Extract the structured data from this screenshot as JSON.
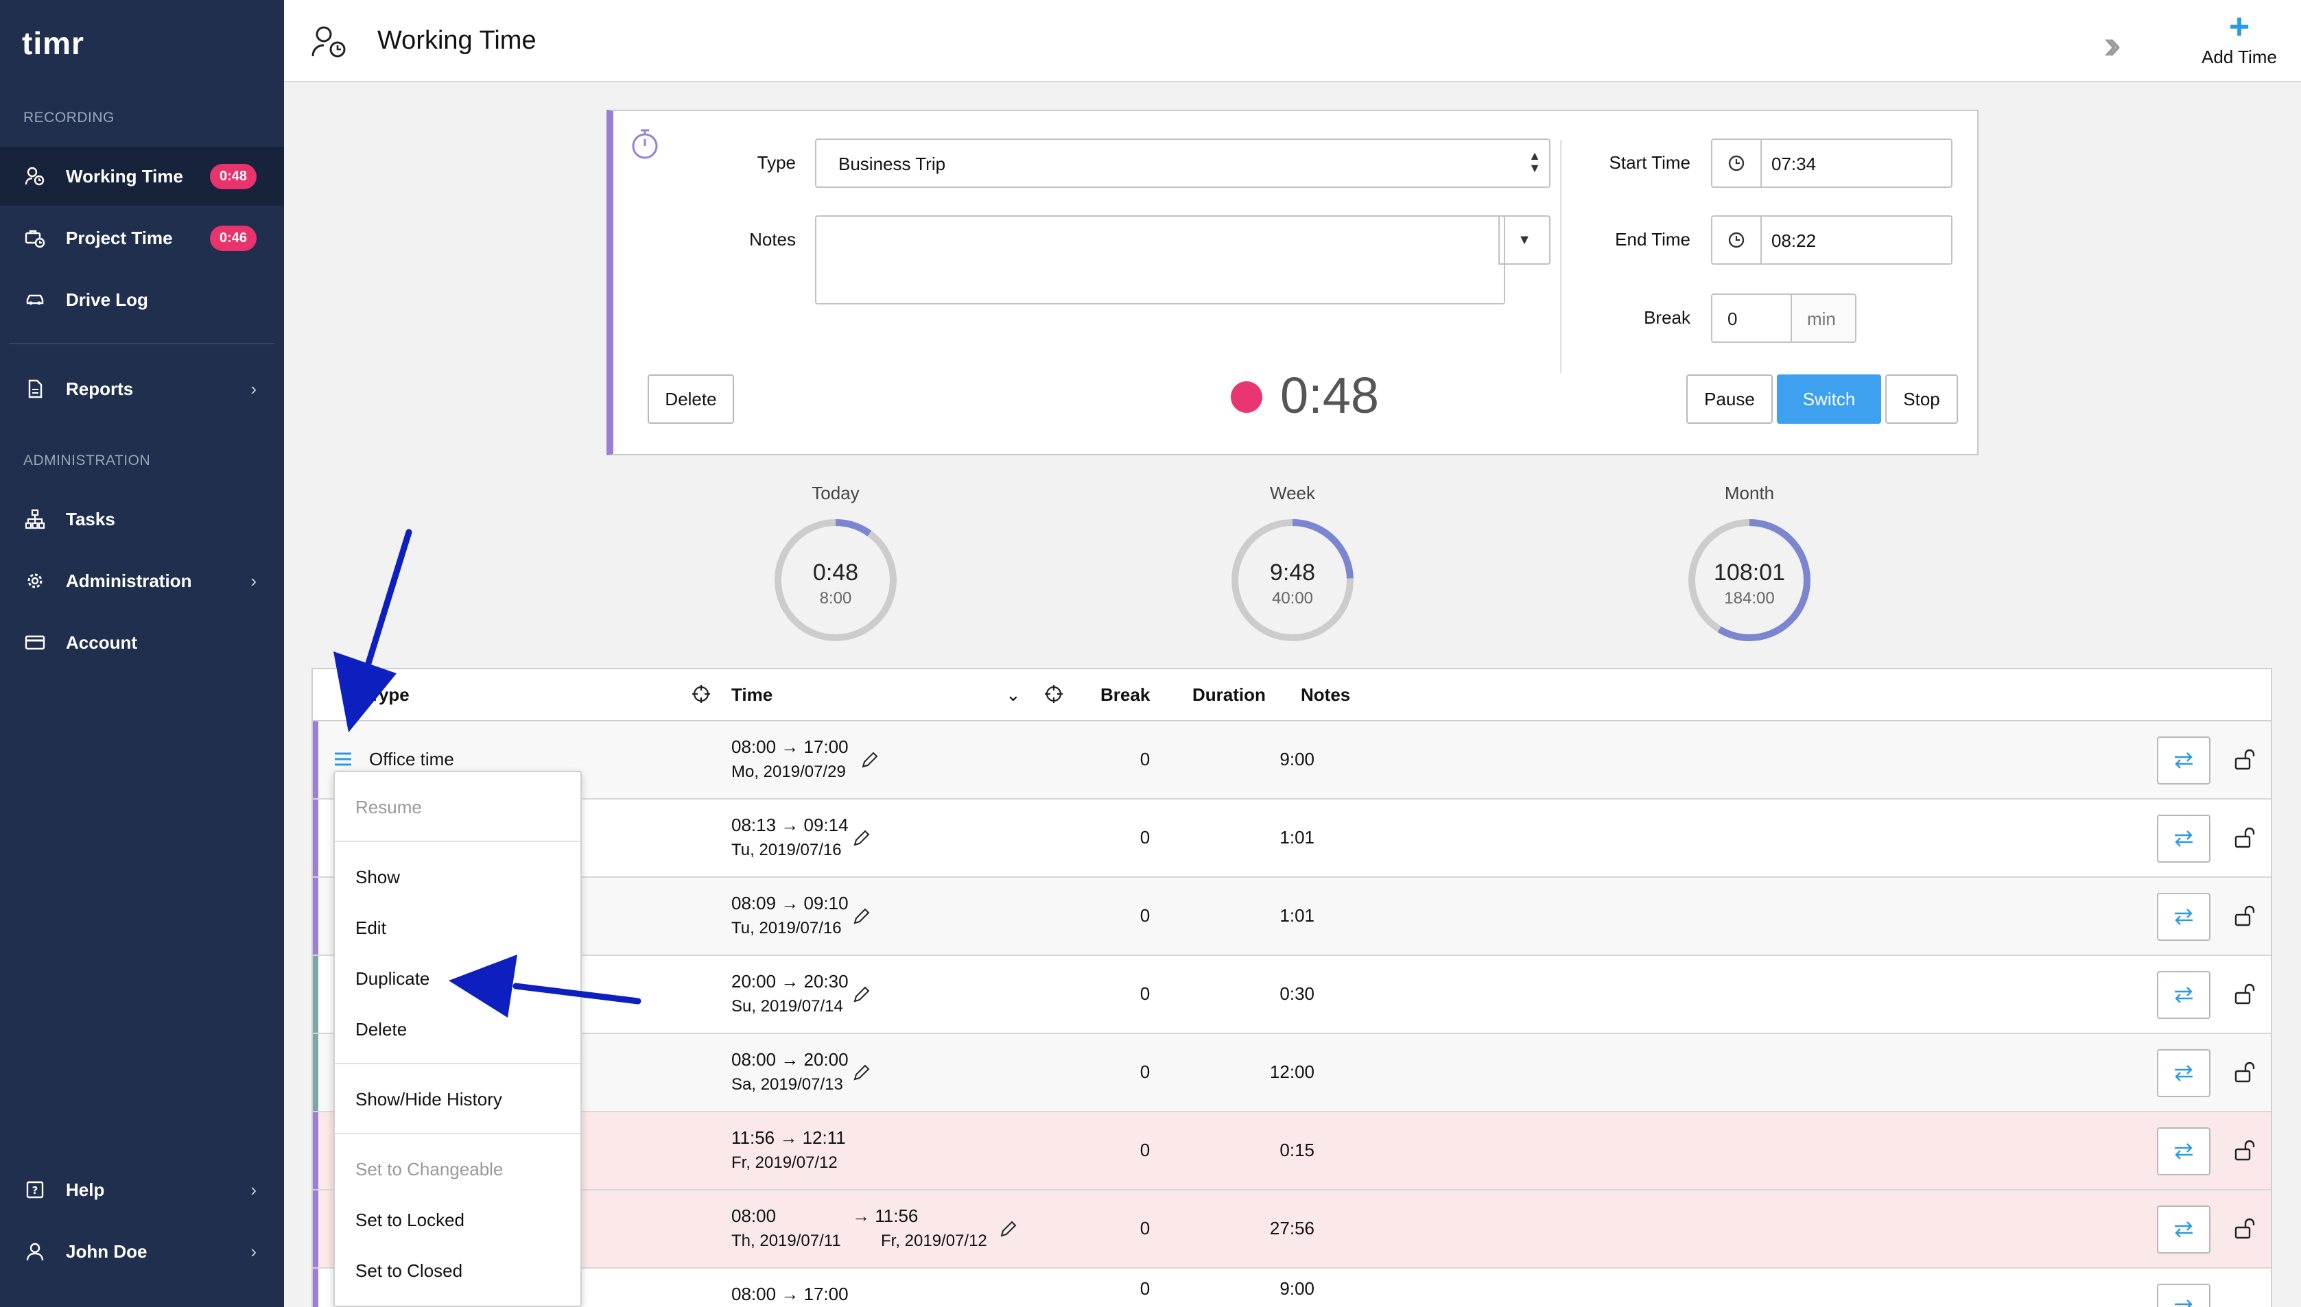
{
  "app": {
    "logo": "timr"
  },
  "sidebar": {
    "recording_label": "RECORDING",
    "administration_label": "ADMINISTRATION",
    "items": [
      {
        "label": "Working Time",
        "badge": "0:48",
        "icon": "user-clock-icon"
      },
      {
        "label": "Project Time",
        "badge": "0:46",
        "icon": "briefcase-clock-icon"
      },
      {
        "label": "Drive Log",
        "icon": "car-icon"
      },
      {
        "label": "Reports",
        "icon": "report-icon"
      },
      {
        "label": "Tasks",
        "icon": "tasks-tree-icon"
      },
      {
        "label": "Administration",
        "icon": "gear-icon"
      },
      {
        "label": "Account",
        "icon": "credit-card-icon"
      },
      {
        "label": "Help",
        "icon": "help-icon"
      },
      {
        "label": "John Doe",
        "icon": "user-icon"
      }
    ]
  },
  "header": {
    "title": "Working Time",
    "add_time_label": "Add Time"
  },
  "timer": {
    "type_label": "Type",
    "type_value": "Business Trip",
    "notes_label": "Notes",
    "notes_value": "",
    "start_label": "Start Time",
    "start_value": "07:34",
    "end_label": "End Time",
    "end_value": "08:22",
    "break_label": "Break",
    "break_value": "0",
    "break_unit": "min",
    "delete_label": "Delete",
    "elapsed": "0:48",
    "pause_label": "Pause",
    "switch_label": "Switch",
    "stop_label": "Stop"
  },
  "summary": [
    {
      "label": "Today",
      "value": "0:48",
      "target": "8:00",
      "fraction": 0.1
    },
    {
      "label": "Week",
      "value": "9:48",
      "target": "40:00",
      "fraction": 0.245
    },
    {
      "label": "Month",
      "value": "108:01",
      "target": "184:00",
      "fraction": 0.587
    }
  ],
  "table": {
    "headers": {
      "type": "Type",
      "time": "Time",
      "break": "Break",
      "duration": "Duration",
      "notes": "Notes"
    },
    "rows": [
      {
        "type": "Office time",
        "time_range": "08:00 → 17:00",
        "date": "Mo, 2019/07/29",
        "break": "0",
        "duration": "9:00"
      },
      {
        "type": "",
        "time_range": "08:13 → 09:14",
        "date": "Tu, 2019/07/16",
        "break": "0",
        "duration": "1:01"
      },
      {
        "type": "",
        "time_range": "08:09 → 09:10",
        "date": "Tu, 2019/07/16",
        "break": "0",
        "duration": "1:01"
      },
      {
        "type": "",
        "time_range": "20:00 → 20:30",
        "date": "Su, 2019/07/14",
        "break": "0",
        "duration": "0:30"
      },
      {
        "type": "",
        "time_range": "08:00 → 20:00",
        "date": "Sa, 2019/07/13",
        "break": "0",
        "duration": "12:00"
      },
      {
        "type": "",
        "time_range": "11:56 → 12:11",
        "date": "Fr, 2019/07/12",
        "break": "0",
        "duration": "0:15"
      },
      {
        "type": "",
        "time_start": "08:00",
        "time_end": "→ 11:56",
        "date": "Th, 2019/07/11",
        "date_end": "Fr, 2019/07/12",
        "break": "0",
        "duration": "27:56"
      },
      {
        "type": "",
        "time_range": "08:00 → 17:00",
        "date": "",
        "break": "0",
        "duration": "9:00"
      }
    ]
  },
  "context_menu": {
    "resume": "Resume",
    "show": "Show",
    "edit": "Edit",
    "duplicate": "Duplicate",
    "delete": "Delete",
    "history": "Show/Hide History",
    "set_changeable": "Set to Changeable",
    "set_locked": "Set to Locked",
    "set_closed": "Set to Closed"
  },
  "colors": {
    "sidebar": "#1f2f4d",
    "accent": "#3ea1f0",
    "badge": "#e8336c",
    "ring": "#7b86d1",
    "stripe_purple": "#9b7fd6",
    "stripe_teal": "#7fa6a6"
  }
}
